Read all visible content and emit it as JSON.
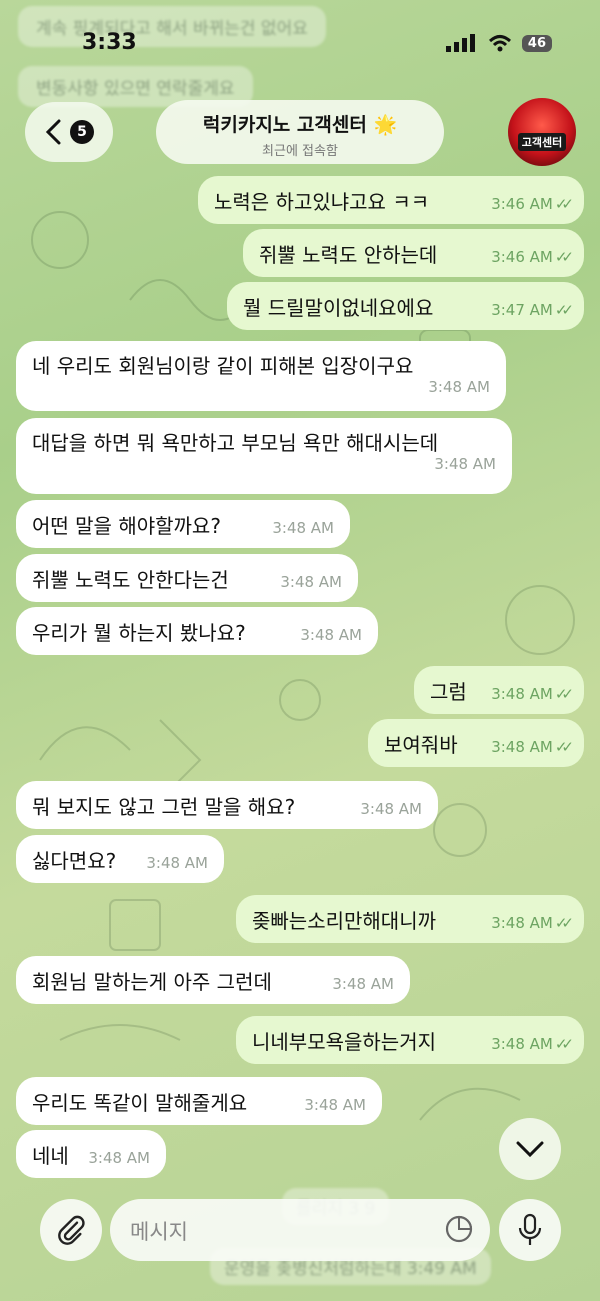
{
  "status_bar": {
    "time": "3:33",
    "battery": "46"
  },
  "background_ghost_messages": [
    "계속 핑계되다고 해서 바뀌는건 없어요",
    "변동사항 있으면 연락줄게요",
    "까 3:46",
    "를리지 3 9",
    "운영을 좆병신처럼하는대 3:49 AM"
  ],
  "header": {
    "back_badge": "5",
    "title": "럭키카지노 고객센터 🌟",
    "subtitle": "최근에 접속함",
    "avatar_text": "고객센터"
  },
  "messages": [
    {
      "dir": "out",
      "text": "노력은 하고있냐고요 ㅋㅋ",
      "time": "3:46 AM"
    },
    {
      "dir": "out",
      "text": "쥐뿔 노력도 안하는데",
      "time": "3:46 AM"
    },
    {
      "dir": "out",
      "text": "뭘 드릴말이없네요에요",
      "time": "3:47 AM"
    },
    {
      "dir": "in",
      "text": "네 우리도 회원님이랑 같이 피해본 입장이구요",
      "time": "3:48 AM"
    },
    {
      "dir": "in",
      "text": "대답을 하면 뭐 욕만하고 부모님 욕만 해대시는데",
      "time": "3:48 AM"
    },
    {
      "dir": "in",
      "text": "어떤 말을 해야할까요?",
      "time": "3:48 AM"
    },
    {
      "dir": "in",
      "text": "쥐뿔 노력도 안한다는건",
      "time": "3:48 AM"
    },
    {
      "dir": "in",
      "text": "우리가 뭘 하는지 봤나요?",
      "time": "3:48 AM"
    },
    {
      "dir": "out",
      "text": "그럼",
      "time": "3:48 AM"
    },
    {
      "dir": "out",
      "text": "보여줘바",
      "time": "3:48 AM"
    },
    {
      "dir": "in",
      "text": "뭐 보지도 않고 그런 말을 해요?",
      "time": "3:48 AM"
    },
    {
      "dir": "in",
      "text": "싫다면요?",
      "time": "3:48 AM"
    },
    {
      "dir": "out",
      "text": "좆빠는소리만해대니까",
      "time": "3:48 AM"
    },
    {
      "dir": "in",
      "text": "회원님 말하는게 아주 그런데",
      "time": "3:48 AM"
    },
    {
      "dir": "out",
      "text": "니네부모욕을하는거지",
      "time": "3:48 AM"
    },
    {
      "dir": "in",
      "text": "우리도 똑같이 말해줄게요",
      "time": "3:48 AM"
    },
    {
      "dir": "in",
      "text": "네네",
      "time": "3:48 AM"
    }
  ],
  "input": {
    "placeholder": "메시지"
  },
  "colors": {
    "incoming": "#ffffff",
    "outgoing": "#e6f8d0",
    "read_check": "#6da462"
  }
}
